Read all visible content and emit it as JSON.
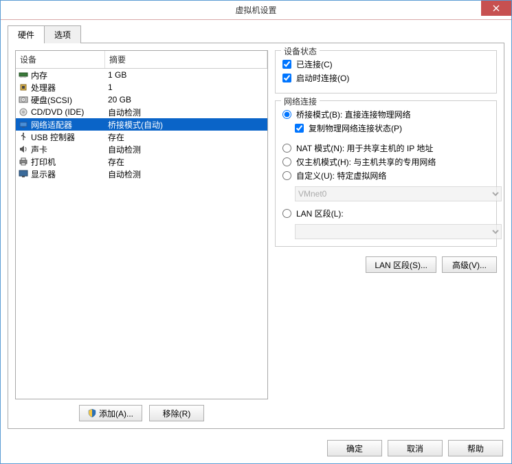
{
  "window": {
    "title": "虚拟机设置"
  },
  "tabs": {
    "hardware": "硬件",
    "options": "选项"
  },
  "table": {
    "h_device": "设备",
    "h_summary": "摘要",
    "rows": [
      {
        "icon": "memory",
        "name": "内存",
        "summary": "1 GB"
      },
      {
        "icon": "cpu",
        "name": "处理器",
        "summary": "1"
      },
      {
        "icon": "hdd",
        "name": "硬盘(SCSI)",
        "summary": "20 GB"
      },
      {
        "icon": "cd",
        "name": "CD/DVD (IDE)",
        "summary": "自动检测"
      },
      {
        "icon": "net",
        "name": "网络适配器",
        "summary": "桥接模式(自动)",
        "selected": true
      },
      {
        "icon": "usb",
        "name": "USB 控制器",
        "summary": "存在"
      },
      {
        "icon": "sound",
        "name": "声卡",
        "summary": "自动检测"
      },
      {
        "icon": "print",
        "name": "打印机",
        "summary": "存在"
      },
      {
        "icon": "display",
        "name": "显示器",
        "summary": "自动检测"
      }
    ]
  },
  "leftButtons": {
    "add": "添加(A)...",
    "remove": "移除(R)"
  },
  "status": {
    "title": "设备状态",
    "connected": "已连接(C)",
    "connectAtPower": "启动时连接(O)"
  },
  "netconn": {
    "title": "网络连接",
    "bridged": "桥接模式(B): 直接连接物理网络",
    "replicate": "复制物理网络连接状态(P)",
    "nat": "NAT 模式(N): 用于共享主机的 IP 地址",
    "hostonly": "仅主机模式(H): 与主机共享的专用网络",
    "custom": "自定义(U): 特定虚拟网络",
    "customSel": "VMnet0",
    "lan": "LAN 区段(L):",
    "lanSel": ""
  },
  "rightButtons": {
    "lanseg": "LAN 区段(S)...",
    "advanced": "高级(V)..."
  },
  "dialogButtons": {
    "ok": "确定",
    "cancel": "取消",
    "help": "帮助"
  }
}
